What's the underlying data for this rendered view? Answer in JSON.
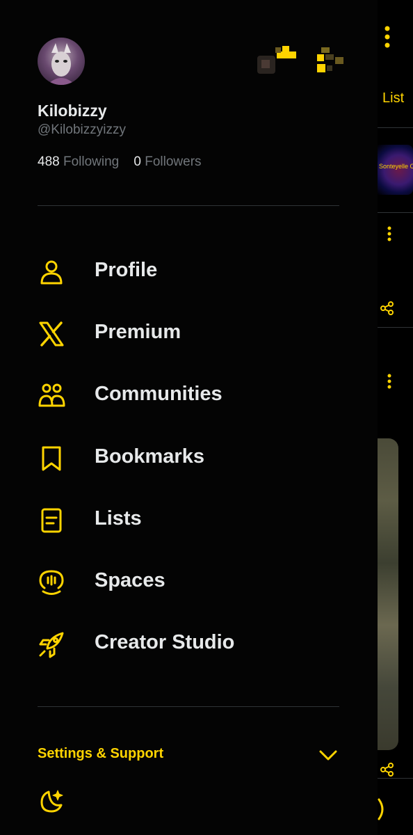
{
  "drawer": {
    "profile": {
      "display_name": "Kilobizzy",
      "handle": "@Kilobizzyizzy",
      "following_count": "488",
      "following_label": "Following",
      "followers_count": "0",
      "followers_label": "Followers"
    },
    "menu": [
      {
        "id": "profile",
        "label": "Profile",
        "icon": "person-icon"
      },
      {
        "id": "premium",
        "label": "Premium",
        "icon": "x-logo-icon"
      },
      {
        "id": "communities",
        "label": "Communities",
        "icon": "people-icon"
      },
      {
        "id": "bookmarks",
        "label": "Bookmarks",
        "icon": "bookmark-icon"
      },
      {
        "id": "lists",
        "label": "Lists",
        "icon": "list-icon"
      },
      {
        "id": "spaces",
        "label": "Spaces",
        "icon": "microphone-icon"
      },
      {
        "id": "creator-studio",
        "label": "Creator Studio",
        "icon": "rocket-icon"
      }
    ],
    "settings_label": "Settings & Support",
    "accent_color": "#ffd400"
  },
  "background": {
    "tab_label": "List",
    "community_badge_text": "Sonteyelle Community"
  }
}
